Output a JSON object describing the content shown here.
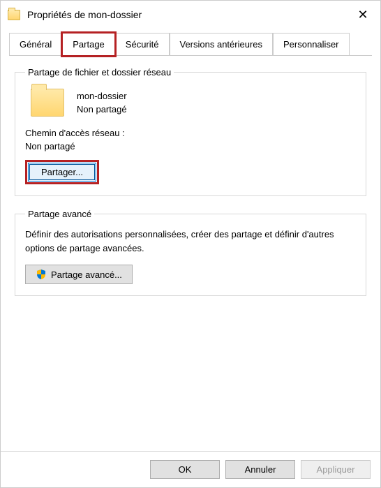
{
  "window": {
    "title": "Propriétés de mon-dossier"
  },
  "tabs": {
    "general": "Général",
    "partage": "Partage",
    "securite": "Sécurité",
    "versions": "Versions antérieures",
    "personnaliser": "Personnaliser"
  },
  "network_sharing": {
    "legend": "Partage de fichier et dossier réseau",
    "folder_name": "mon-dossier",
    "share_status": "Non partagé",
    "path_label": "Chemin d'accès réseau :",
    "path_value": "Non partagé",
    "share_button": "Partager..."
  },
  "advanced_sharing": {
    "legend": "Partage avancé",
    "description": "Définir des autorisations personnalisées, créer des partage et définir d'autres options de partage avancées.",
    "button": "Partage avancé..."
  },
  "footer": {
    "ok": "OK",
    "cancel": "Annuler",
    "apply": "Appliquer"
  }
}
